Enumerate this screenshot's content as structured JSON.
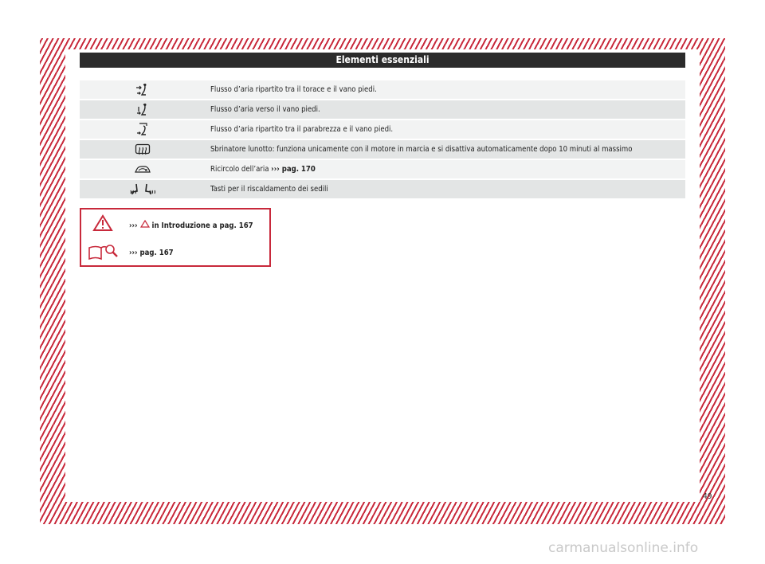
{
  "header": {
    "title": "Elementi essenziali"
  },
  "rows": [
    {
      "icon": "airflow-chest-feet-icon",
      "text": "Flusso d’aria ripartito tra il torace e il vano piedi.",
      "ref": ""
    },
    {
      "icon": "airflow-feet-icon",
      "text": "Flusso d’aria verso il vano piedi.",
      "ref": ""
    },
    {
      "icon": "airflow-windscreen-feet-icon",
      "text": "Flusso d’aria ripartito tra il parabrezza e il vano piedi.",
      "ref": ""
    },
    {
      "icon": "rear-window-defrost-icon",
      "text": "Sbrinatore lunotto: funziona unicamente con il motore in marcia e si disattiva automaticamente dopo 10 minuti al massimo",
      "ref": ""
    },
    {
      "icon": "air-recirculation-icon",
      "text": "Ricircolo dell’aria",
      "ref": "››› pag. 170"
    },
    {
      "icon": "seat-heating-icon",
      "text": "Tasti per il riscaldamento dei sedili",
      "ref": ""
    }
  ],
  "notes": {
    "warning_prefix": "›››",
    "warning_text": "in Introduzione a pag. 167",
    "book_text": "››› pag. 167"
  },
  "page_number": "49",
  "watermark": "carmanualsonline.info",
  "colors": {
    "accent": "#c8293b",
    "header_bg": "#2b2b2b"
  }
}
